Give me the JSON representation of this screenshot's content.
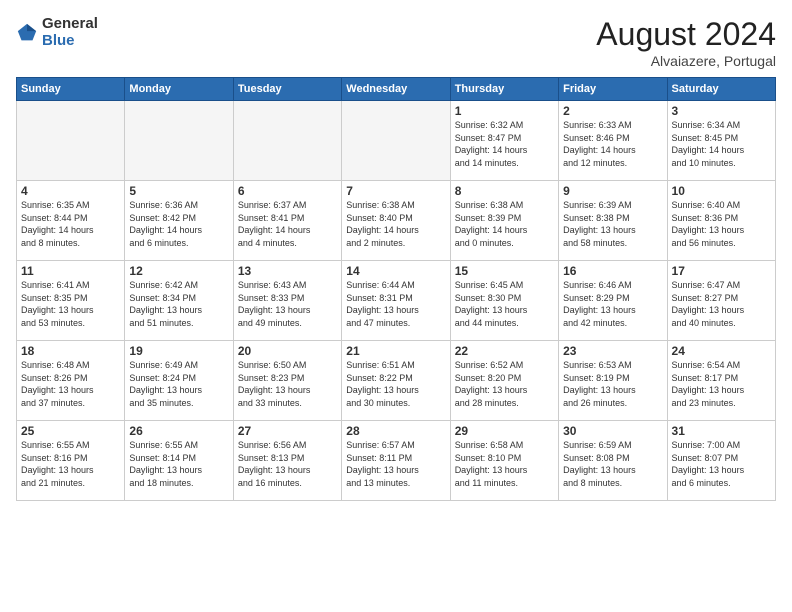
{
  "logo": {
    "general": "General",
    "blue": "Blue"
  },
  "header": {
    "month": "August 2024",
    "location": "Alvaiazere, Portugal"
  },
  "weekdays": [
    "Sunday",
    "Monday",
    "Tuesday",
    "Wednesday",
    "Thursday",
    "Friday",
    "Saturday"
  ],
  "weeks": [
    [
      {
        "day": "",
        "info": ""
      },
      {
        "day": "",
        "info": ""
      },
      {
        "day": "",
        "info": ""
      },
      {
        "day": "",
        "info": ""
      },
      {
        "day": "1",
        "info": "Sunrise: 6:32 AM\nSunset: 8:47 PM\nDaylight: 14 hours\nand 14 minutes."
      },
      {
        "day": "2",
        "info": "Sunrise: 6:33 AM\nSunset: 8:46 PM\nDaylight: 14 hours\nand 12 minutes."
      },
      {
        "day": "3",
        "info": "Sunrise: 6:34 AM\nSunset: 8:45 PM\nDaylight: 14 hours\nand 10 minutes."
      }
    ],
    [
      {
        "day": "4",
        "info": "Sunrise: 6:35 AM\nSunset: 8:44 PM\nDaylight: 14 hours\nand 8 minutes."
      },
      {
        "day": "5",
        "info": "Sunrise: 6:36 AM\nSunset: 8:42 PM\nDaylight: 14 hours\nand 6 minutes."
      },
      {
        "day": "6",
        "info": "Sunrise: 6:37 AM\nSunset: 8:41 PM\nDaylight: 14 hours\nand 4 minutes."
      },
      {
        "day": "7",
        "info": "Sunrise: 6:38 AM\nSunset: 8:40 PM\nDaylight: 14 hours\nand 2 minutes."
      },
      {
        "day": "8",
        "info": "Sunrise: 6:38 AM\nSunset: 8:39 PM\nDaylight: 14 hours\nand 0 minutes."
      },
      {
        "day": "9",
        "info": "Sunrise: 6:39 AM\nSunset: 8:38 PM\nDaylight: 13 hours\nand 58 minutes."
      },
      {
        "day": "10",
        "info": "Sunrise: 6:40 AM\nSunset: 8:36 PM\nDaylight: 13 hours\nand 56 minutes."
      }
    ],
    [
      {
        "day": "11",
        "info": "Sunrise: 6:41 AM\nSunset: 8:35 PM\nDaylight: 13 hours\nand 53 minutes."
      },
      {
        "day": "12",
        "info": "Sunrise: 6:42 AM\nSunset: 8:34 PM\nDaylight: 13 hours\nand 51 minutes."
      },
      {
        "day": "13",
        "info": "Sunrise: 6:43 AM\nSunset: 8:33 PM\nDaylight: 13 hours\nand 49 minutes."
      },
      {
        "day": "14",
        "info": "Sunrise: 6:44 AM\nSunset: 8:31 PM\nDaylight: 13 hours\nand 47 minutes."
      },
      {
        "day": "15",
        "info": "Sunrise: 6:45 AM\nSunset: 8:30 PM\nDaylight: 13 hours\nand 44 minutes."
      },
      {
        "day": "16",
        "info": "Sunrise: 6:46 AM\nSunset: 8:29 PM\nDaylight: 13 hours\nand 42 minutes."
      },
      {
        "day": "17",
        "info": "Sunrise: 6:47 AM\nSunset: 8:27 PM\nDaylight: 13 hours\nand 40 minutes."
      }
    ],
    [
      {
        "day": "18",
        "info": "Sunrise: 6:48 AM\nSunset: 8:26 PM\nDaylight: 13 hours\nand 37 minutes."
      },
      {
        "day": "19",
        "info": "Sunrise: 6:49 AM\nSunset: 8:24 PM\nDaylight: 13 hours\nand 35 minutes."
      },
      {
        "day": "20",
        "info": "Sunrise: 6:50 AM\nSunset: 8:23 PM\nDaylight: 13 hours\nand 33 minutes."
      },
      {
        "day": "21",
        "info": "Sunrise: 6:51 AM\nSunset: 8:22 PM\nDaylight: 13 hours\nand 30 minutes."
      },
      {
        "day": "22",
        "info": "Sunrise: 6:52 AM\nSunset: 8:20 PM\nDaylight: 13 hours\nand 28 minutes."
      },
      {
        "day": "23",
        "info": "Sunrise: 6:53 AM\nSunset: 8:19 PM\nDaylight: 13 hours\nand 26 minutes."
      },
      {
        "day": "24",
        "info": "Sunrise: 6:54 AM\nSunset: 8:17 PM\nDaylight: 13 hours\nand 23 minutes."
      }
    ],
    [
      {
        "day": "25",
        "info": "Sunrise: 6:55 AM\nSunset: 8:16 PM\nDaylight: 13 hours\nand 21 minutes."
      },
      {
        "day": "26",
        "info": "Sunrise: 6:55 AM\nSunset: 8:14 PM\nDaylight: 13 hours\nand 18 minutes."
      },
      {
        "day": "27",
        "info": "Sunrise: 6:56 AM\nSunset: 8:13 PM\nDaylight: 13 hours\nand 16 minutes."
      },
      {
        "day": "28",
        "info": "Sunrise: 6:57 AM\nSunset: 8:11 PM\nDaylight: 13 hours\nand 13 minutes."
      },
      {
        "day": "29",
        "info": "Sunrise: 6:58 AM\nSunset: 8:10 PM\nDaylight: 13 hours\nand 11 minutes."
      },
      {
        "day": "30",
        "info": "Sunrise: 6:59 AM\nSunset: 8:08 PM\nDaylight: 13 hours\nand 8 minutes."
      },
      {
        "day": "31",
        "info": "Sunrise: 7:00 AM\nSunset: 8:07 PM\nDaylight: 13 hours\nand 6 minutes."
      }
    ]
  ]
}
